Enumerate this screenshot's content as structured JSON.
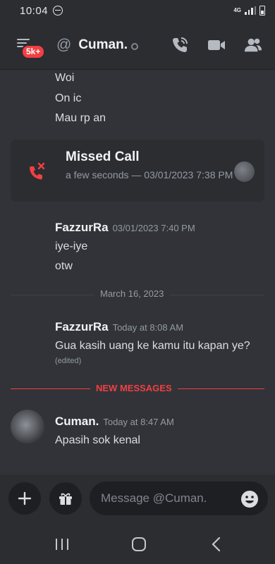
{
  "status_bar": {
    "time": "10:04",
    "network": "4G"
  },
  "header": {
    "badge": "5k+",
    "title": "Cuman."
  },
  "messages": {
    "prev_lines": [
      "Woi",
      "On ic",
      "Mau rp an"
    ],
    "missed_call": {
      "title": "Missed Call",
      "subtitle": "a few seconds — 03/01/2023 7:38 PM"
    },
    "group1": {
      "author": "FazzurRa",
      "timestamp": "03/01/2023 7:40 PM",
      "lines": [
        "iye-iye",
        "otw"
      ]
    },
    "date_divider": "March 16, 2023",
    "group2": {
      "author": "FazzurRa",
      "timestamp": "Today at 8:08 AM",
      "text": "Gua kasih uang ke kamu itu kapan ye?",
      "edited": "(edited)"
    },
    "new_messages_label": "NEW MESSAGES",
    "group3": {
      "author": "Cuman.",
      "timestamp": "Today at 8:47 AM",
      "text": "Apasih sok kenal"
    }
  },
  "composer": {
    "placeholder": "Message @Cuman."
  },
  "colors": {
    "background": "#313338",
    "header": "#2b2d31",
    "accent_red": "#f23f43",
    "muted_text": "#949ba4"
  },
  "icons": [
    "dnd-icon",
    "signal-icon",
    "battery-icon",
    "menu-icon",
    "at-icon",
    "call-icon",
    "video-icon",
    "members-icon",
    "missed-call-icon",
    "plus-icon",
    "gift-icon",
    "emoji-icon",
    "recent-apps-icon",
    "home-icon",
    "back-icon"
  ]
}
